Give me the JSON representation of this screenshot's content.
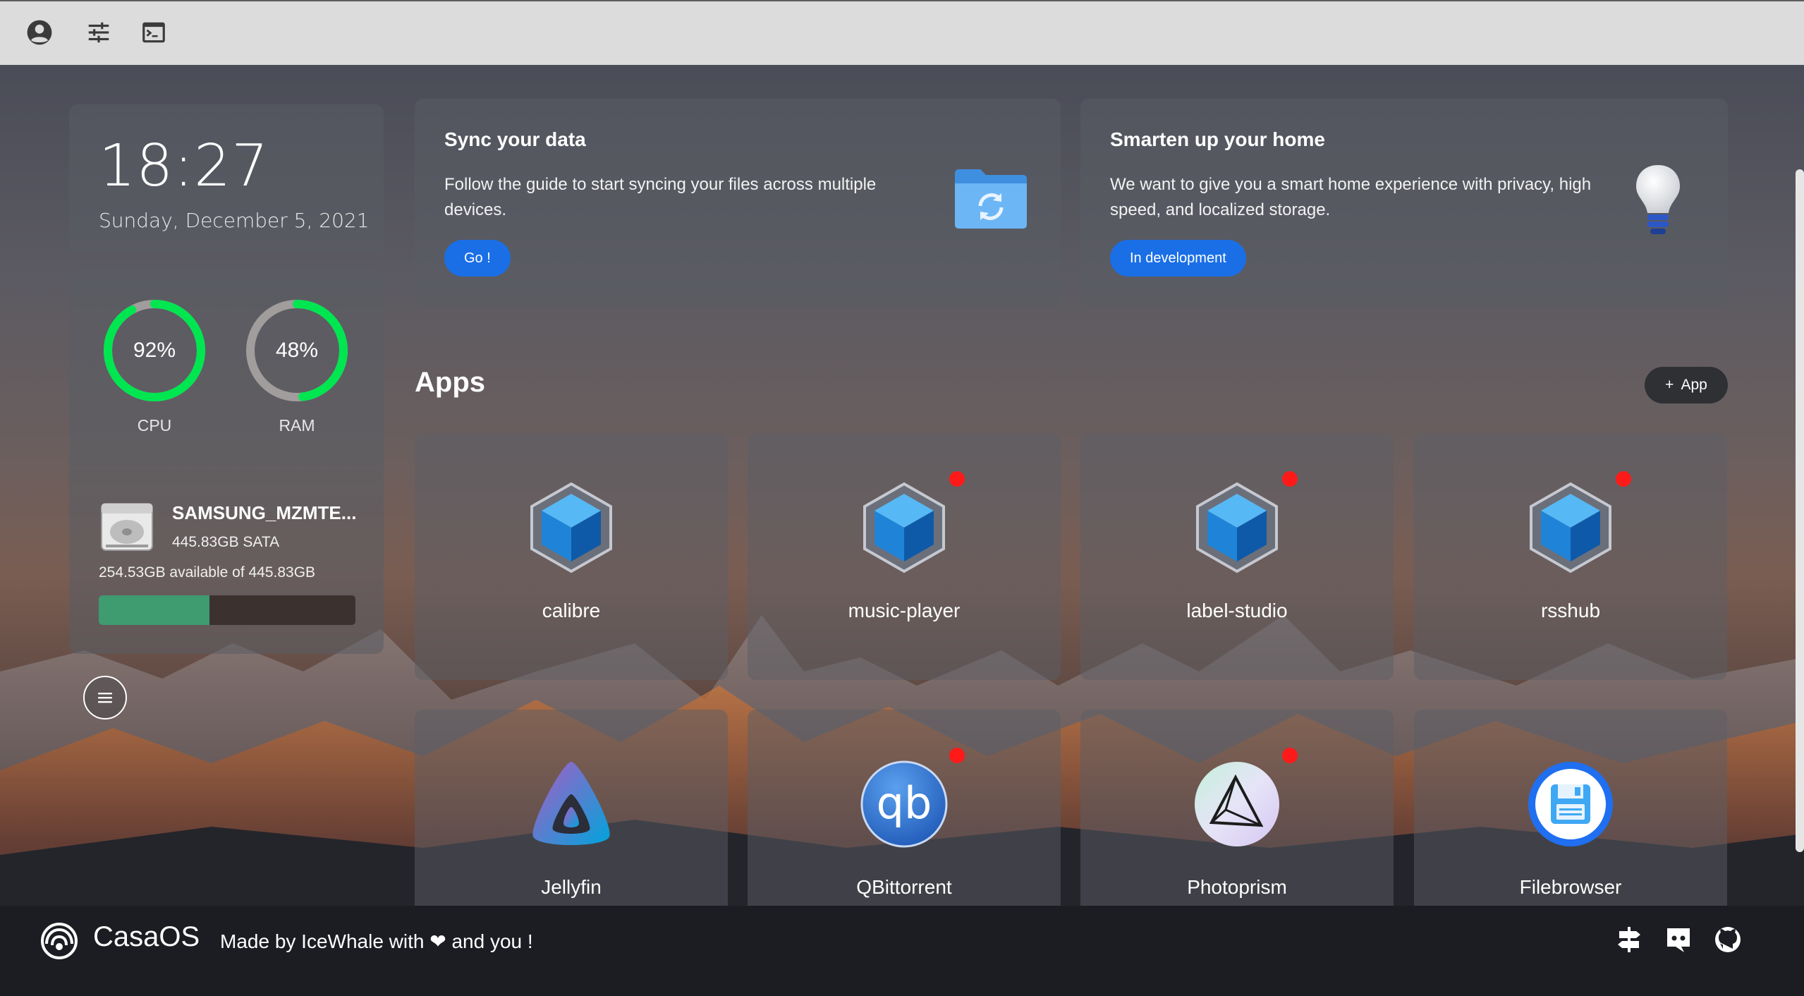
{
  "topbar": {
    "icons": [
      "account-icon",
      "settings-sliders-icon",
      "terminal-icon"
    ]
  },
  "clock": {
    "time": "18:27",
    "date": "Sunday, December 5, 2021"
  },
  "status": {
    "cpu": {
      "percent": 92,
      "label_text": "92%",
      "label": "CPU"
    },
    "ram": {
      "percent": 48,
      "label_text": "48%",
      "label": "RAM"
    },
    "disk": {
      "name": "SAMSUNG_MZMTE...",
      "type": "445.83GB SATA",
      "available": "254.53GB available of 445.83GB",
      "used_fraction": 0.43
    }
  },
  "promos": {
    "sync": {
      "title": "Sync your data",
      "text": "Follow the guide to start syncing your files across multiple devices.",
      "button": "Go !"
    },
    "home": {
      "title": "Smarten up your home",
      "text": "We want to give you a smart home experience with privacy, high speed, and localized storage.",
      "button": "In development"
    }
  },
  "apps": {
    "title": "Apps",
    "add_label": "App",
    "items": [
      {
        "name": "calibre",
        "icon": "box-icon",
        "badge": false
      },
      {
        "name": "music-player",
        "icon": "box-icon",
        "badge": true
      },
      {
        "name": "label-studio",
        "icon": "box-icon",
        "badge": true
      },
      {
        "name": "rsshub",
        "icon": "box-icon",
        "badge": true
      },
      {
        "name": "Jellyfin",
        "icon": "jellyfin-icon",
        "badge": false
      },
      {
        "name": "QBittorrent",
        "icon": "qbittorrent-icon",
        "badge": true
      },
      {
        "name": "Photoprism",
        "icon": "photoprism-icon",
        "badge": true
      },
      {
        "name": "Filebrowser",
        "icon": "filebrowser-icon",
        "badge": false
      }
    ]
  },
  "footer": {
    "brand": "CasaOS",
    "tagline": "Made by IceWhale with ❤ and you !",
    "links": [
      "signpost-icon",
      "discord-icon",
      "github-icon"
    ]
  },
  "colors": {
    "accent": "#1a6fe6",
    "gauge": "#00e650",
    "badge": "#ff1a1a",
    "disk_bar": "#3f9b70"
  }
}
